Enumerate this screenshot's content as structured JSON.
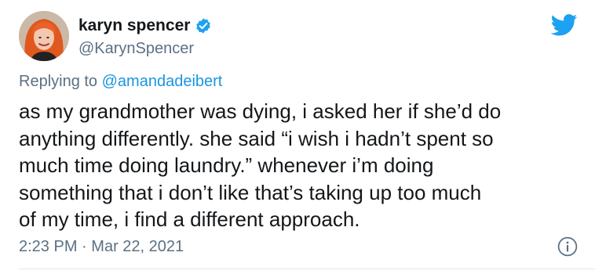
{
  "author": {
    "display_name": "karyn spencer",
    "handle": "@KarynSpencer"
  },
  "reply": {
    "prefix": "Replying to",
    "to_handle": "@amandadeibert"
  },
  "tweet": {
    "text": "as my grandmother was dying, i asked her if she’d do\nanything differently. she said “i wish i hadn’t spent so\nmuch time doing laundry.” whenever i’m doing\nsomething that i don’t like that’s taking up too much\nof my time, i find a different approach.",
    "time": "2:23 PM",
    "separator": "·",
    "date": "Mar 22, 2021"
  },
  "icons": {
    "verified": "verified-badge-icon",
    "brand": "twitter-bird-icon",
    "info": "info-icon"
  },
  "colors": {
    "brand_blue": "#1da1f2",
    "link_blue": "#1b95e0",
    "secondary_text": "#5b7083",
    "primary_text": "#14171a",
    "avatar_hair": "#e0581e"
  }
}
